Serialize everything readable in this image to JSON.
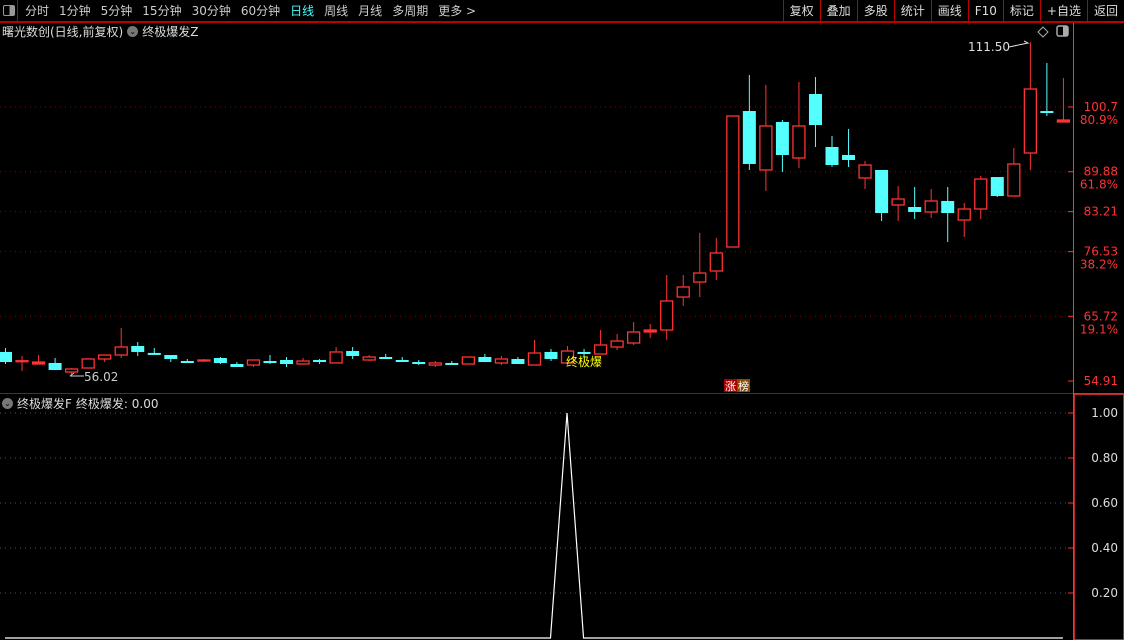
{
  "toolbar": {
    "periods": [
      "分时",
      "1分钟",
      "5分钟",
      "15分钟",
      "30分钟",
      "60分钟",
      "日线",
      "周线",
      "月线",
      "多周期",
      "更多 >"
    ],
    "active_period": "日线",
    "buttons": [
      "复权",
      "叠加",
      "多股",
      "统计",
      "画线",
      "F10",
      "标记",
      "+自选",
      "返回"
    ]
  },
  "main_panel": {
    "title": "曙光数创(日线,前复权)",
    "indicator": "终极爆发Z"
  },
  "sub_panel": {
    "indicator": "终极爆发F",
    "value_label": "终极爆发: 0.00"
  },
  "colors": {
    "up": "#ff3333",
    "down": "#54ffff",
    "axis": "#ff3333",
    "grid": "#8b0000",
    "signal": "#ffff00"
  },
  "chart_data": [
    {
      "type": "candlestick",
      "price_axis": {
        "ticks": [
          100.7,
          89.88,
          83.21,
          76.53,
          65.72,
          54.91
        ],
        "pct_labels": {
          "100.7": "80.9%",
          "89.88": "61.8%",
          "76.53": "38.2%",
          "65.72": "19.1%"
        }
      },
      "annotations": {
        "low": "56.02",
        "high": "111.50",
        "signal_text": "终极爆",
        "badge": [
          "涨",
          "榜"
        ]
      },
      "signal_index": 34,
      "candles_ohlc": [
        [
          59.76,
          58.08,
          60.42,
          57.75
        ],
        [
          58.25,
          58.3,
          59.09,
          56.58
        ],
        [
          57.75,
          58.08,
          59.25,
          57.75
        ],
        [
          57.92,
          56.75,
          58.75,
          56.75
        ],
        [
          56.41,
          56.92,
          57.08,
          56.02
        ],
        [
          57.08,
          58.59,
          58.59,
          57.08
        ],
        [
          58.59,
          59.25,
          59.25,
          58.08
        ],
        [
          59.25,
          60.59,
          63.77,
          58.75
        ],
        [
          60.76,
          59.76,
          61.43,
          59.09
        ],
        [
          59.6,
          59.55,
          60.42,
          59.25
        ],
        [
          59.25,
          58.59,
          59.25,
          58.08
        ],
        [
          58.25,
          58.2,
          58.59,
          57.92
        ],
        [
          58.4,
          58.42,
          58.59,
          58.08
        ],
        [
          58.75,
          57.92,
          58.92,
          57.75
        ],
        [
          57.75,
          57.25,
          58.08,
          57.25
        ],
        [
          57.58,
          58.42,
          58.42,
          57.25
        ],
        [
          58.25,
          58.2,
          59.25,
          57.75
        ],
        [
          58.42,
          57.75,
          58.92,
          57.25
        ],
        [
          57.75,
          58.25,
          58.75,
          57.75
        ],
        [
          58.42,
          58.38,
          58.59,
          57.75
        ],
        [
          57.92,
          59.76,
          60.59,
          57.92
        ],
        [
          59.92,
          59.09,
          60.59,
          58.59
        ],
        [
          58.42,
          58.92,
          59.25,
          58.25
        ],
        [
          58.92,
          58.88,
          59.42,
          58.59
        ],
        [
          58.42,
          58.38,
          58.92,
          58.08
        ],
        [
          58.08,
          57.75,
          58.42,
          57.58
        ],
        [
          57.58,
          57.92,
          58.25,
          57.25
        ],
        [
          57.92,
          57.88,
          58.25,
          57.58
        ],
        [
          57.75,
          58.92,
          58.92,
          57.75
        ],
        [
          58.92,
          58.08,
          59.42,
          58.08
        ],
        [
          57.92,
          58.59,
          59.09,
          57.58
        ],
        [
          58.59,
          57.75,
          58.92,
          57.75
        ],
        [
          57.58,
          59.59,
          61.76,
          57.58
        ],
        [
          59.76,
          58.59,
          60.26,
          58.25
        ],
        [
          57.92,
          59.92,
          60.76,
          57.58
        ],
        [
          59.76,
          59.72,
          60.26,
          58.92
        ],
        [
          59.42,
          60.93,
          63.43,
          59.42
        ],
        [
          60.59,
          61.59,
          62.76,
          60.09
        ],
        [
          61.26,
          63.1,
          64.77,
          60.93
        ],
        [
          63.1,
          63.43,
          64.43,
          62.09
        ],
        [
          63.43,
          68.28,
          72.62,
          61.76
        ],
        [
          68.94,
          70.62,
          72.62,
          67.44
        ],
        [
          71.45,
          72.95,
          79.64,
          68.94
        ],
        [
          73.29,
          76.3,
          78.8,
          71.79
        ],
        [
          77.3,
          99.19,
          99.19,
          77.3
        ],
        [
          100.02,
          91.17,
          106.04,
          90.17
        ],
        [
          90.17,
          97.52,
          104.37,
          86.66
        ],
        [
          98.19,
          92.67,
          98.52,
          89.83
        ],
        [
          92.17,
          97.52,
          104.87,
          90.5
        ],
        [
          102.86,
          97.68,
          105.7,
          94.01
        ],
        [
          94.01,
          91.0,
          95.85,
          90.67
        ],
        [
          92.67,
          91.84,
          97.02,
          90.67
        ],
        [
          88.83,
          91.0,
          91.67,
          86.99
        ],
        [
          90.17,
          82.98,
          90.17,
          81.64
        ],
        [
          84.32,
          85.32,
          87.49,
          81.64
        ],
        [
          83.98,
          83.15,
          87.32,
          81.98
        ],
        [
          83.15,
          84.99,
          86.99,
          82.15
        ],
        [
          84.99,
          82.98,
          87.32,
          78.13
        ],
        [
          81.81,
          83.65,
          84.65,
          78.97
        ],
        [
          83.65,
          88.66,
          89.16,
          81.98
        ],
        [
          88.99,
          85.82,
          88.99,
          85.65
        ],
        [
          85.82,
          91.17,
          93.84,
          85.82
        ],
        [
          93.01,
          103.7,
          111.5,
          90.17
        ],
        [
          100.02,
          99.69,
          108.04,
          99.19
        ],
        [
          98.19,
          98.52,
          105.53,
          98.19
        ]
      ]
    },
    {
      "type": "line",
      "name": "终极爆发",
      "y_ticks": [
        "1.00",
        "0.80",
        "0.60",
        "0.40",
        "0.20"
      ],
      "ylim": [
        0,
        1
      ],
      "values_note_index_of_spike": 34,
      "value_at_spike": 1,
      "baseline": 0
    }
  ]
}
